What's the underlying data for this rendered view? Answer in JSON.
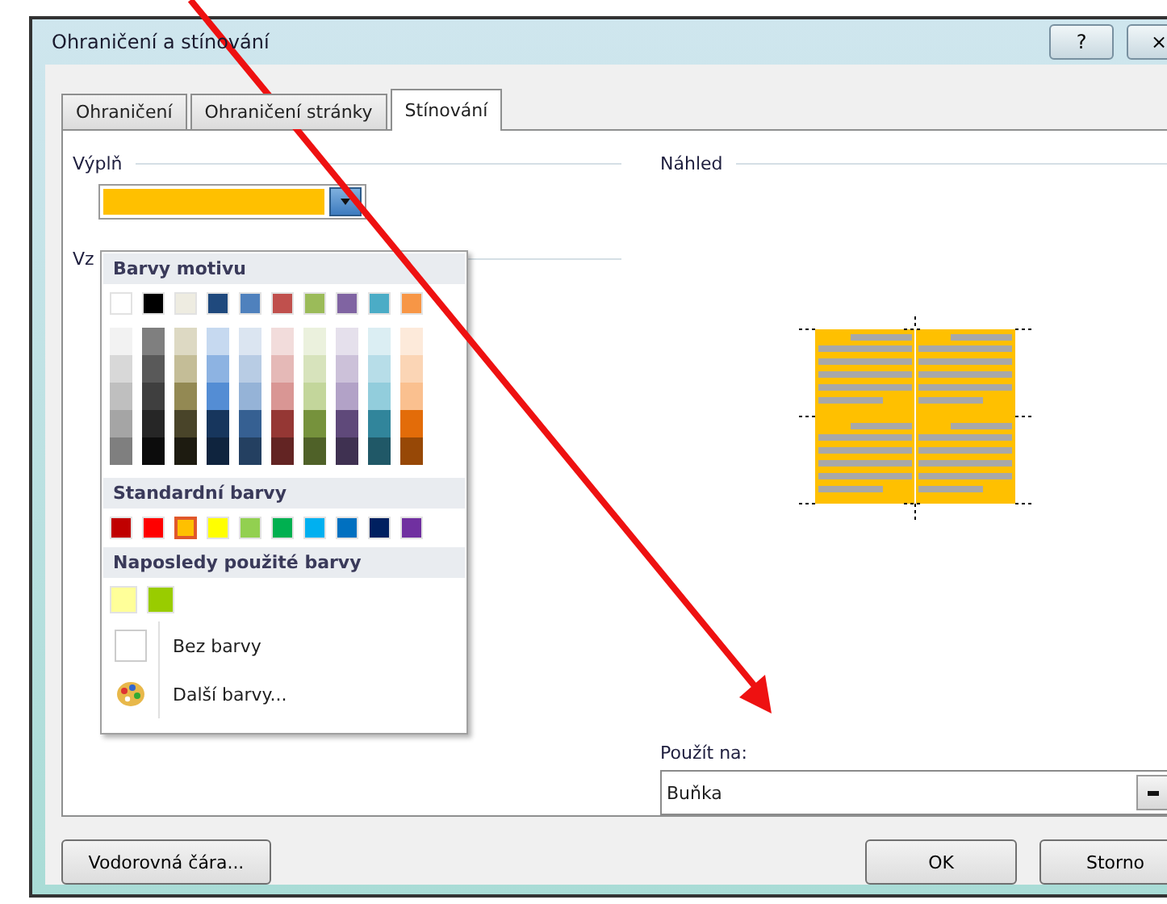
{
  "window": {
    "title": "Ohraničení a stínování",
    "title_buttons": [
      {
        "label": "?"
      },
      {
        "label": "×"
      }
    ]
  },
  "tabs": [
    {
      "label": "Ohraničení",
      "selected": false
    },
    {
      "label": "Ohraničení stránky",
      "selected": false
    },
    {
      "label": "Stínování",
      "selected": true
    }
  ],
  "fill": {
    "label": "Výplň",
    "color": "#ffc000"
  },
  "pattern": {
    "label": "Vz"
  },
  "palette": {
    "theme_title": "Barvy motivu",
    "theme_colors": [
      {
        "color": "#ffffff",
        "shades": [
          {
            "color": "#f2f2f2"
          },
          {
            "color": "#d8d8d8"
          },
          {
            "color": "#bfbfbf"
          },
          {
            "color": "#a5a5a5"
          },
          {
            "color": "#7f7f7f"
          }
        ]
      },
      {
        "color": "#000000",
        "shades": [
          {
            "color": "#7f7f7f"
          },
          {
            "color": "#595959"
          },
          {
            "color": "#3f3f3f"
          },
          {
            "color": "#262626"
          },
          {
            "color": "#0c0c0c"
          }
        ]
      },
      {
        "color": "#eeece1",
        "shades": [
          {
            "color": "#ddd9c3"
          },
          {
            "color": "#c4bd97"
          },
          {
            "color": "#938953"
          },
          {
            "color": "#494429"
          },
          {
            "color": "#1d1b10"
          }
        ]
      },
      {
        "color": "#1f497d",
        "shades": [
          {
            "color": "#c6d9f0"
          },
          {
            "color": "#8db3e2"
          },
          {
            "color": "#548dd4"
          },
          {
            "color": "#17365d"
          },
          {
            "color": "#0f243e"
          }
        ]
      },
      {
        "color": "#4f81bd",
        "shades": [
          {
            "color": "#dbe5f1"
          },
          {
            "color": "#b8cce4"
          },
          {
            "color": "#95b3d7"
          },
          {
            "color": "#366092"
          },
          {
            "color": "#244061"
          }
        ]
      },
      {
        "color": "#c0504d",
        "shades": [
          {
            "color": "#f2dcdb"
          },
          {
            "color": "#e5b9b7"
          },
          {
            "color": "#d99694"
          },
          {
            "color": "#953734"
          },
          {
            "color": "#632423"
          }
        ]
      },
      {
        "color": "#9bbb59",
        "shades": [
          {
            "color": "#ebf1dd"
          },
          {
            "color": "#d7e3bc"
          },
          {
            "color": "#c3d69b"
          },
          {
            "color": "#76923c"
          },
          {
            "color": "#4f6128"
          }
        ]
      },
      {
        "color": "#8064a2",
        "shades": [
          {
            "color": "#e5e0ec"
          },
          {
            "color": "#ccc1d9"
          },
          {
            "color": "#b2a2c7"
          },
          {
            "color": "#5f497a"
          },
          {
            "color": "#3f3151"
          }
        ]
      },
      {
        "color": "#4bacc6",
        "shades": [
          {
            "color": "#dbeef3"
          },
          {
            "color": "#b7dde8"
          },
          {
            "color": "#92cddc"
          },
          {
            "color": "#31859b"
          },
          {
            "color": "#205867"
          }
        ]
      },
      {
        "color": "#f79646",
        "shades": [
          {
            "color": "#fdeada"
          },
          {
            "color": "#fbd5b5"
          },
          {
            "color": "#fac08f"
          },
          {
            "color": "#e36c09"
          },
          {
            "color": "#974806"
          }
        ]
      }
    ],
    "standard_title": "Standardní barvy",
    "standard_colors": [
      {
        "color": "#c00000",
        "selected": false
      },
      {
        "color": "#ff0000",
        "selected": false
      },
      {
        "color": "#ffc000",
        "selected": true
      },
      {
        "color": "#ffff00",
        "selected": false
      },
      {
        "color": "#92d050",
        "selected": false
      },
      {
        "color": "#00b050",
        "selected": false
      },
      {
        "color": "#00b0f0",
        "selected": false
      },
      {
        "color": "#0070c0",
        "selected": false
      },
      {
        "color": "#002060",
        "selected": false
      },
      {
        "color": "#7030a0",
        "selected": false
      }
    ],
    "recent_title": "Naposledy použité barvy",
    "recent_colors": [
      {
        "color": "#ffff99"
      },
      {
        "color": "#99cc00"
      }
    ],
    "items": [
      {
        "kind": "none",
        "label": "Bez barvy"
      },
      {
        "kind": "more",
        "label": "Další barvy..."
      }
    ]
  },
  "preview": {
    "label": "Náhled",
    "color": "#ffc000"
  },
  "apply_to": {
    "label": "Použít na:",
    "value": "Buňka"
  },
  "buttons": [
    {
      "label": "Vodorovná čára..."
    },
    {
      "label": "OK"
    },
    {
      "label": "Storno"
    }
  ]
}
